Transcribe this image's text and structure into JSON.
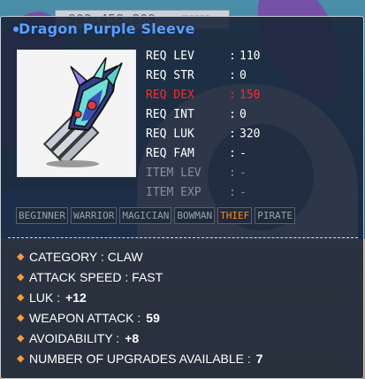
{
  "meso": {
    "amount": "902,458,809",
    "unit": "mesos"
  },
  "tooltip": {
    "title": "Dragon Purple Sleeve",
    "requirements": [
      {
        "key": "REQ LEV",
        "value": "110",
        "state": "normal"
      },
      {
        "key": "REQ STR",
        "value": "0",
        "state": "normal"
      },
      {
        "key": "REQ DEX",
        "value": "150",
        "state": "unmet"
      },
      {
        "key": "REQ INT",
        "value": "0",
        "state": "normal"
      },
      {
        "key": "REQ LUK",
        "value": "320",
        "state": "normal"
      },
      {
        "key": "REQ FAM",
        "value": "-",
        "state": "normal"
      },
      {
        "key": "ITEM LEV",
        "value": "-",
        "state": "dim"
      },
      {
        "key": "ITEM EXP",
        "value": "-",
        "state": "dim"
      }
    ],
    "jobs": [
      {
        "label": "BEGINNER",
        "active": false
      },
      {
        "label": "WARRIOR",
        "active": false
      },
      {
        "label": "MAGICIAN",
        "active": false
      },
      {
        "label": "BOWMAN",
        "active": false
      },
      {
        "label": "THIEF",
        "active": true
      },
      {
        "label": "PIRATE",
        "active": false
      }
    ],
    "properties": [
      {
        "label": "CATEGORY : CLAW",
        "value": ""
      },
      {
        "label": "ATTACK SPEED : FAST",
        "value": ""
      },
      {
        "label": "LUK : ",
        "value": "+12"
      },
      {
        "label": "WEAPON ATTACK : ",
        "value": "59"
      },
      {
        "label": "AVOIDABILITY : ",
        "value": "+8"
      },
      {
        "label": "NUMBER OF UPGRADES AVAILABLE : ",
        "value": "7"
      }
    ],
    "icon": "dragon-claw-icon",
    "colors": {
      "title": "#5aa0ff",
      "unmet": "#ff2a2a",
      "active_job": "#ff8a1a",
      "bullet": "#ff9a3a"
    }
  }
}
